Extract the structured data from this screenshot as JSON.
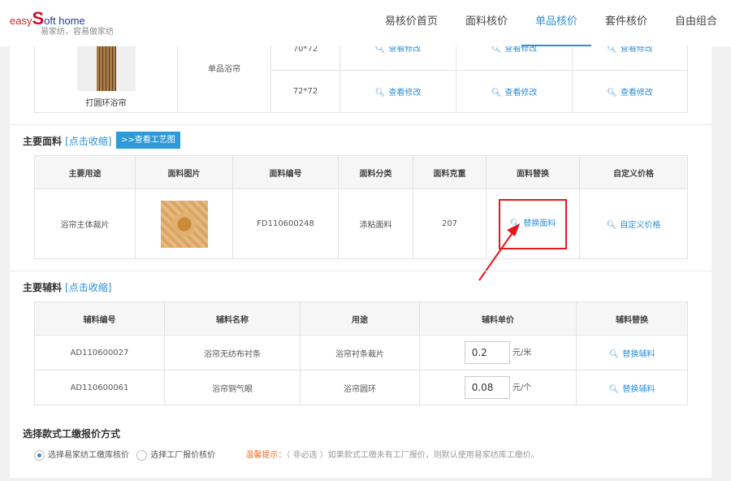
{
  "header": {
    "logo": {
      "easy": "easy",
      "s": "S",
      "home": "oft home",
      "tagline": "易家纺，容易做家纺"
    },
    "nav": [
      {
        "label": "易核价首页",
        "active": false
      },
      {
        "label": "面料核价",
        "active": false
      },
      {
        "label": "单品核价",
        "active": true
      },
      {
        "label": "套件核价",
        "active": false
      },
      {
        "label": "自由组合",
        "active": false
      }
    ]
  },
  "product": {
    "name": "打圆环浴帘",
    "type": "单品浴帘",
    "sizes": [
      "70*72",
      "72*72"
    ],
    "action": "查看修改"
  },
  "fabric": {
    "title": "主要面料",
    "toggle": "[点击收缩]",
    "button": ">>查看工艺图",
    "headers": [
      "主要用途",
      "面料图片",
      "面料编号",
      "面料分类",
      "面料克重",
      "面料替换",
      "自定义价格"
    ],
    "rows": [
      {
        "use": "浴帘主体裁片",
        "code": "FD110600248",
        "category": "涤粘面料",
        "weight": "207",
        "replace": "替换面料",
        "custom": "自定义价格"
      }
    ]
  },
  "accessory": {
    "title": "主要辅料",
    "toggle": "[点击收缩]",
    "headers": [
      "辅料编号",
      "辅料名称",
      "用途",
      "辅料单价",
      "辅料替换"
    ],
    "rows": [
      {
        "code": "AD110600027",
        "name": "浴帘无纺布衬条",
        "use": "浴帘衬条裁片",
        "price": "0.2",
        "unit": "元/米",
        "replace": "替换辅料"
      },
      {
        "code": "AD110600061",
        "name": "浴帘铜气眼",
        "use": "浴帘圆环",
        "price": "0.08",
        "unit": "元/个",
        "replace": "替换辅料"
      }
    ]
  },
  "pricing": {
    "title": "选择款式工缴报价方式",
    "options": [
      {
        "label": "选择易家纺工缴库核价",
        "selected": true
      },
      {
        "label": "选择工厂报价核价",
        "selected": false
      }
    ],
    "tip_label": "温馨提示：",
    "tip_text": "（ 非必选 ）如果款式工缴未有工厂报价，则默认使用易家纺库工缴价。"
  },
  "colors": {
    "accent": "#2e8fd8",
    "highlight": "#e8161b",
    "tip": "#f26d21"
  }
}
